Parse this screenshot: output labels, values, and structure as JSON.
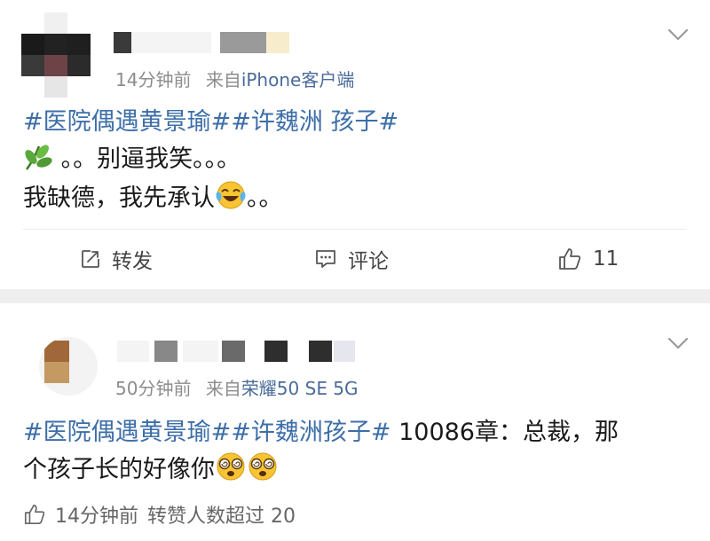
{
  "post1": {
    "meta_time": "14分钟前",
    "meta_from": "来自",
    "meta_source": "iPhone客户端",
    "hashtags": "#医院偶遇黄景瑜##许魏洲 孩子#",
    "line1": "。。别逼我笑。。。",
    "line2_text": "我缺德，我先承认",
    "line2_tail": "。。",
    "actions": {
      "repost_label": "转发",
      "comment_label": "评论",
      "like_count": "11"
    }
  },
  "post2": {
    "meta_time": "50分钟前",
    "meta_from": "来自",
    "meta_source": "荣耀50 SE 5G",
    "hashtags": "#医院偶遇黄景瑜##许魏洲孩子#",
    "line1_tail": " 10086章：总裁，那",
    "line2_text": "个孩子长的好像你",
    "footer_time": "14分钟前",
    "footer_likes": "转赞人数超过 20"
  },
  "colors": {
    "hashtag": "#3d6ea8",
    "source": "#4a6b99",
    "meta": "#8c8c8c",
    "separator": "#efefef"
  },
  "icons": {
    "repost": "repost-icon",
    "comment": "comment-icon",
    "like": "thumbs-up-icon",
    "more": "chevron-down-icon",
    "leaf": "herb-emoji",
    "laugh": "laughing-crying-emoji",
    "dizzy": "dizzy-face-emoji"
  }
}
